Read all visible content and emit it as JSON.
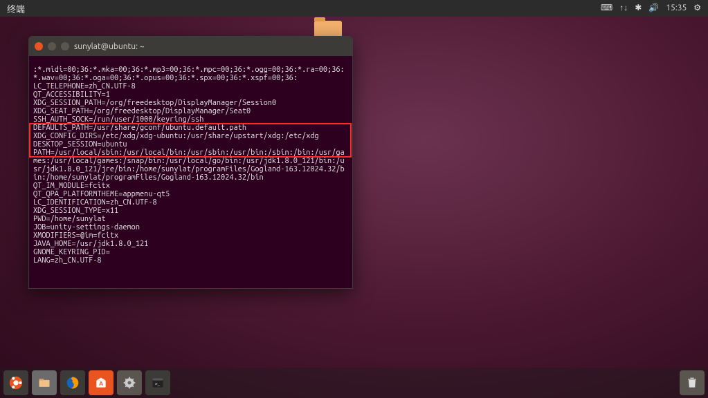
{
  "menubar": {
    "appname": "终端",
    "time": "15:35"
  },
  "titlebar": {
    "title": "sunylat@ubuntu: ~"
  },
  "term": {
    "l1": ":*.midi=00;36:*.mka=00;36:*.mp3=00;36:*.mpc=00;36:*.ogg=00;36:*.ra=00;36:*.wav=00;36:*.oga=00;36:*.opus=00;36:*.spx=00;36:*.xspf=00;36:",
    "l2": "LC_TELEPHONE=zh_CN.UTF-8",
    "l3": "QT_ACCESSIBILITY=1",
    "l4": "XDG_SESSION_PATH=/org/freedesktop/DisplayManager/Session0",
    "l5": "XDG_SEAT_PATH=/org/freedesktop/DisplayManager/Seat0",
    "l6": "SSH_AUTH_SOCK=/run/user/1000/keyring/ssh",
    "l7": "DEFAULTS_PATH=/usr/share/gconf/ubuntu.default.path",
    "l8": "XDG_CONFIG_DIRS=/etc/xdg/xdg-ubuntu:/usr/share/upstart/xdg:/etc/xdg",
    "l9": "DESKTOP_SESSION=ubuntu",
    "l10": "PATH=/usr/local/sbin:/usr/local/bin:/usr/sbin:/usr/bin:/sbin:/bin:/usr/games:/usr/local/games:/snap/bin:/usr/local/go/bin:/usr/jdk1.8.0_121/bin:/usr/jdk1.8.0_121/jre/bin:/home/sunylat/programFiles/Gogland-163.12024.32/bin:/home/sunylat/programFiles/Gogland-163.12024.32/bin",
    "l11": "QT_IM_MODULE=fcitx",
    "l12": "QT_QPA_PLATFORMTHEME=appmenu-qt5",
    "l13": "LC_IDENTIFICATION=zh_CN.UTF-8",
    "l14": "XDG_SESSION_TYPE=x11",
    "l15": "PWD=/home/sunylat",
    "l16": "JOB=unity-settings-daemon",
    "l17": "XMODIFIERS=@im=fcitx",
    "l18": "JAVA_HOME=/usr/jdk1.8.0_121",
    "l19": "GNOME_KEYRING_PID=",
    "l20": "LANG=zh_CN.UTF-8"
  }
}
